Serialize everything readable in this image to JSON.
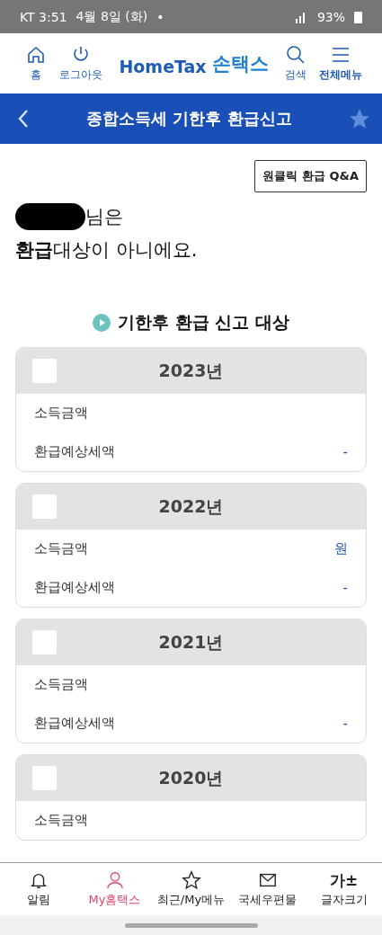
{
  "status_bar": {
    "carrier_time": "KT 3:51",
    "date": "4월 8일 (화)",
    "dot": "•",
    "battery": "93%"
  },
  "header": {
    "left": [
      {
        "label": "홈",
        "kind": "home"
      },
      {
        "label": "로그아웃",
        "kind": "power"
      }
    ],
    "logo": {
      "en": "HomeTax",
      "ko": "손택스"
    },
    "right": [
      {
        "label": "검색",
        "kind": "search",
        "bold": false
      },
      {
        "label": "전체메뉴",
        "kind": "menu",
        "bold": true
      }
    ]
  },
  "title_bar": {
    "title": "종합소득세 기한후 환급신고",
    "favorite": false
  },
  "qa_button": "원클릭 환급 Q&A",
  "greeting": {
    "suffix": "님은",
    "message": "**환급**대상이 아니에요."
  },
  "section_title": "기한후 환급 신고 대상",
  "years": [
    {
      "year": "2023년",
      "checked": false,
      "rows": [
        {
          "label": "소득금액"
        },
        {
          "label": "환급예상세액",
          "value": "-"
        }
      ]
    },
    {
      "year": "2022년",
      "checked": false,
      "rows": [
        {
          "label": "소득금액",
          "value": "원"
        },
        {
          "label": "환급예상세액",
          "value": "-"
        }
      ]
    },
    {
      "year": "2021년",
      "checked": false,
      "rows": [
        {
          "label": "소득금액"
        },
        {
          "label": "환급예상세액",
          "value": "-"
        }
      ]
    },
    {
      "year": "2020년",
      "checked": false,
      "rows": [
        {
          "label": "소득금액"
        }
      ]
    }
  ],
  "bottom_nav": [
    {
      "label": "알림",
      "kind": "bell",
      "selected": false
    },
    {
      "label": "My홈택스",
      "kind": "person",
      "selected": true
    },
    {
      "label": "최근/My메뉴",
      "kind": "star",
      "selected": false
    },
    {
      "label": "국세우편물",
      "kind": "mail",
      "selected": false
    },
    {
      "label": "글자크기",
      "kind": "glyph",
      "glyph": "가±",
      "selected": false
    }
  ]
}
